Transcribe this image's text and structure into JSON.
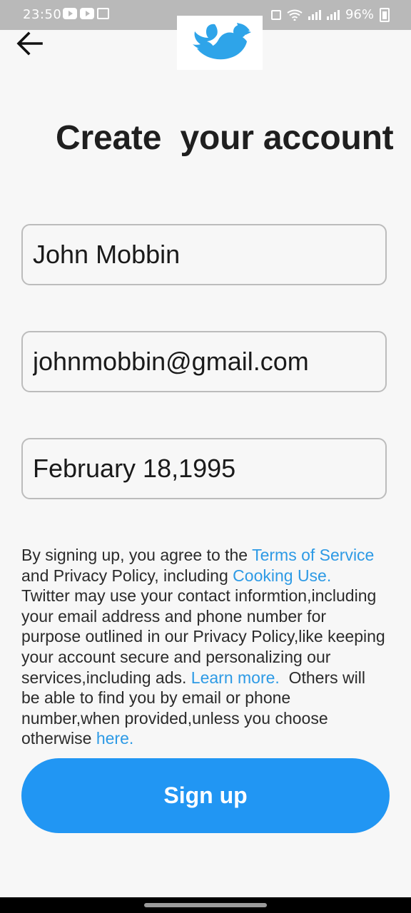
{
  "status_bar": {
    "time": "23:50",
    "battery": "96%"
  },
  "header": {
    "back_icon": "arrow-left-icon",
    "logo_icon": "twitter-bird-icon"
  },
  "page": {
    "title": "Create  your account"
  },
  "form": {
    "name_value": "John Mobbin",
    "email_value": "johnmobbin@gmail.com",
    "dob_value": "February 18,1995"
  },
  "legal": {
    "line1_text": "By signing up, you agree to the ",
    "terms_link": "Terms of Service",
    "line2_text": "and Privacy Policy, including ",
    "cooking_link": "Cooking Use.",
    "line3": "Twitter may use your contact informtion,including",
    "line4": "your email address and phone number for",
    "line5": "purpose outlined in our Privacy Policy,like keeping",
    "line6": "your account secure and personalizing our",
    "line7_text": "services,including ads. ",
    "learn_more_link": "Learn more.",
    "line7_after": "  Others will",
    "line8": "be able to find you by email or phone",
    "line9": "number,when provided,unless you choose",
    "line10_text": "otherwise ",
    "here_link": "here."
  },
  "actions": {
    "signup_label": "Sign up"
  },
  "colors": {
    "accent": "#2196f3",
    "link": "#2d9ae5",
    "border": "#bcbcbc",
    "status_bar": "#b9b9b9"
  }
}
